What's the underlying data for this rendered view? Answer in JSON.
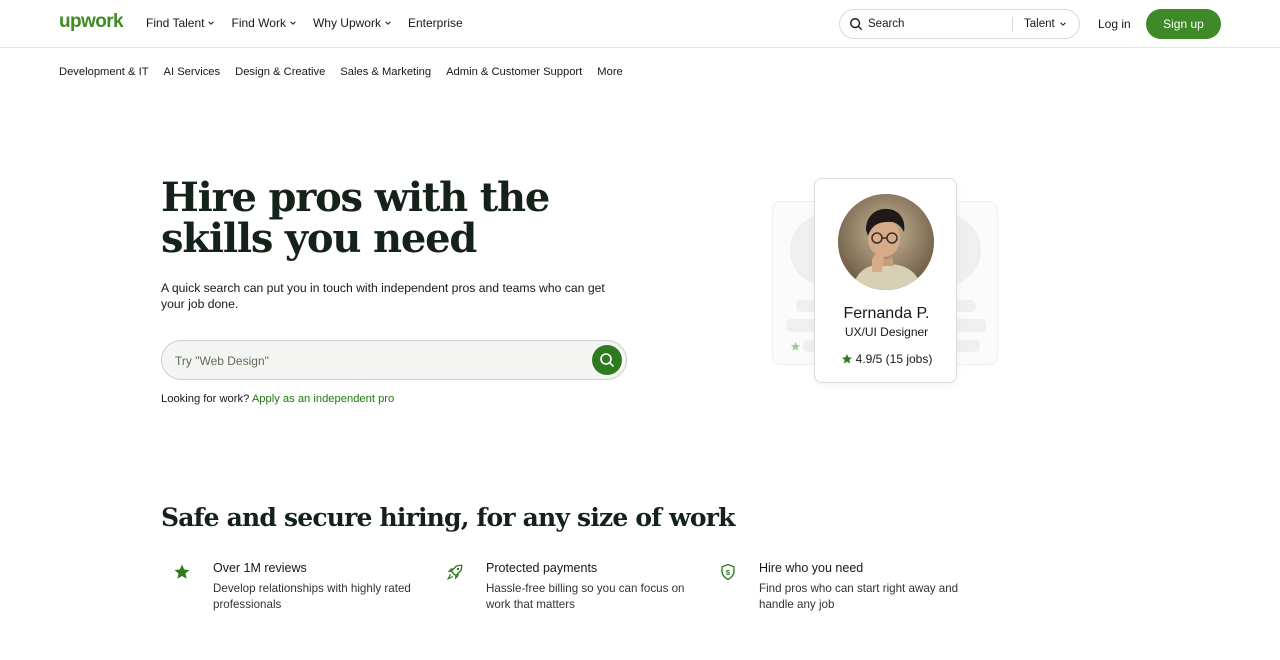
{
  "header": {
    "logo": "upwork",
    "nav": [
      {
        "label": "Find Talent",
        "has_dropdown": true
      },
      {
        "label": "Find Work",
        "has_dropdown": true
      },
      {
        "label": "Why Upwork",
        "has_dropdown": true
      },
      {
        "label": "Enterprise",
        "has_dropdown": false
      }
    ],
    "search": {
      "label": "Search",
      "scope": "Talent"
    },
    "login": "Log in",
    "signup": "Sign up"
  },
  "categories": [
    "Development & IT",
    "AI Services",
    "Design & Creative",
    "Sales & Marketing",
    "Admin & Customer Support",
    "More"
  ],
  "hero": {
    "title": "Hire pros with the skills you need",
    "subtitle": "A quick search can put you in touch with independent pros and teams who can get your job done.",
    "search_placeholder": "Try \"Web Design\"",
    "work_prompt": "Looking for work?",
    "work_link": "Apply as an independent pro"
  },
  "profile": {
    "name": "Fernanda P.",
    "role": "UX/UI Designer",
    "rating": "4.9/5 (15 jobs)"
  },
  "safe": {
    "title": "Safe and secure hiring, for any size of work",
    "features": [
      {
        "icon": "star-icon",
        "title": "Over 1M reviews",
        "desc": "Develop relationships with highly rated professionals"
      },
      {
        "icon": "rocket-icon",
        "title": "Protected payments",
        "desc": "Hassle-free billing so you can focus on work that matters"
      },
      {
        "icon": "shield-dollar-icon",
        "title": "Hire who you need",
        "desc": "Find pros who can start right away and handle any job"
      }
    ]
  },
  "colors": {
    "brand": "#3f8a28",
    "accent_dark": "#2f7a1e",
    "link": "#1f7a10"
  }
}
